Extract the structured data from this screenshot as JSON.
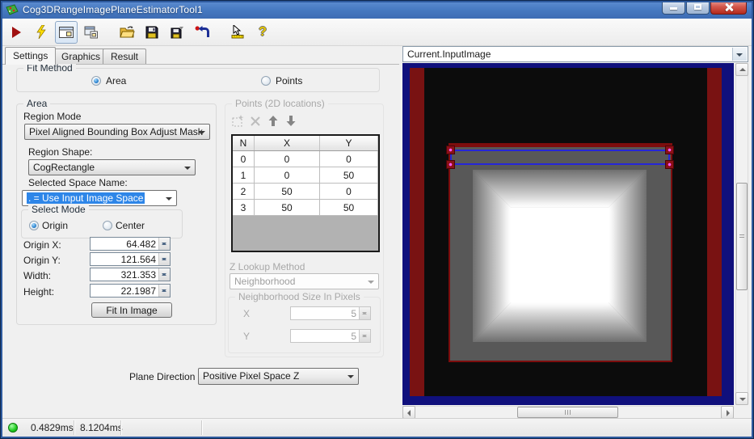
{
  "window": {
    "title": "Cog3DRangeImagePlaneEstimatorTool1"
  },
  "toolbar": {
    "buttons": [
      "run",
      "live-run",
      "show-image-electrode",
      "float-window",
      "open",
      "save",
      "save-as",
      "reset",
      "pointer-tool",
      "help"
    ],
    "help_glyph": "?"
  },
  "tabs": {
    "settings": "Settings",
    "graphics": "Graphics",
    "result": "Result"
  },
  "fit_method": {
    "label": "Fit Method",
    "area": "Area",
    "points": "Points",
    "selected": "Area"
  },
  "area": {
    "label": "Area",
    "region_mode_label": "Region Mode",
    "region_mode_value": "Pixel Aligned Bounding Box Adjust Mask",
    "region_shape_label": "Region Shape:",
    "region_shape_value": "CogRectangle",
    "selected_space_label": "Selected Space Name:",
    "selected_space_value": ". = Use Input Image Space",
    "select_mode_label": "Select Mode",
    "select_mode_origin": "Origin",
    "select_mode_center": "Center",
    "select_mode_selected": "Origin",
    "origin_x_label": "Origin X:",
    "origin_x_value": "64.482",
    "origin_y_label": "Origin Y:",
    "origin_y_value": "121.564",
    "width_label": "Width:",
    "width_value": "321.353",
    "height_label": "Height:",
    "height_value": "22.1987",
    "fit_button_label": "Fit In Image"
  },
  "points": {
    "label": "Points (2D locations)",
    "table": {
      "headers": [
        "N",
        "X",
        "Y"
      ],
      "rows": [
        [
          "0",
          "0",
          "0"
        ],
        [
          "1",
          "0",
          "50"
        ],
        [
          "2",
          "50",
          "0"
        ],
        [
          "3",
          "50",
          "50"
        ]
      ]
    },
    "z_lookup_label": "Z Lookup Method",
    "z_lookup_value": "Neighborhood",
    "neighborhood_label": "Neighborhood Size In Pixels",
    "nx_label": "X",
    "nx_value": "5",
    "ny_label": "Y",
    "ny_value": "5"
  },
  "plane_direction": {
    "label": "Plane Direction",
    "value": "Positive Pixel Space Z"
  },
  "display": {
    "source": "Current.InputImage"
  },
  "status": {
    "time1": "0.4829ms",
    "time2": "8.1204ms"
  },
  "colors": {
    "titlebar": "#4578c0",
    "selection": "#2e86e8",
    "led_green": "#1ecb1e",
    "mask_red": "#7d0d0d",
    "overlay_blue": "#2626d8",
    "handle_magenta": "#ff5aff",
    "image_red_bar": "#791212",
    "image_border_navy": "#10107c"
  }
}
